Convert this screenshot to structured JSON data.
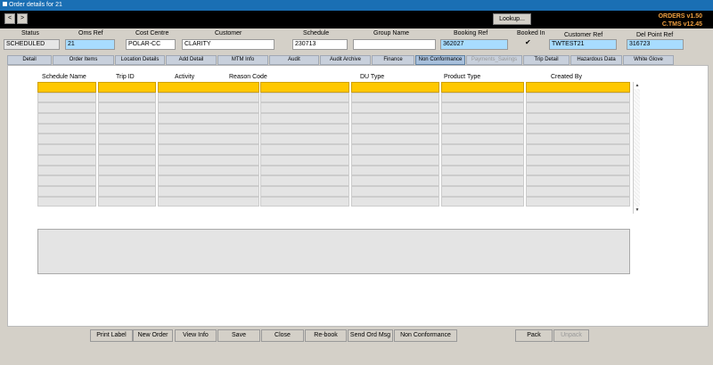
{
  "window": {
    "title": "Order details for 21"
  },
  "toolbar": {
    "prev": "<",
    "next": ">",
    "lookup": "Lookup...",
    "version1": "ORDERS v1.50",
    "version2": "C.TMS v12.45"
  },
  "fields": {
    "status_label": "Status",
    "status_value": "SCHEDULED",
    "oms_label": "Oms Ref",
    "oms_value": "21",
    "cost_label": "Cost Centre",
    "cost_value": "POLAR-CC",
    "customer_label": "Customer",
    "customer_value": "CLARITY",
    "schedule_label": "Schedule",
    "schedule_value": "230713",
    "group_label": "Group Name",
    "group_value": "",
    "booking_label": "Booking Ref",
    "booking_value": "362027",
    "booked_label": "Booked In",
    "booked_mark": "✔",
    "custref_label": "Customer Ref",
    "custref_value": "TWTEST21",
    "delpoint_label": "Del Point Ref",
    "delpoint_value": "316723"
  },
  "tabs": [
    "Detail",
    "Order Items",
    "Location Details",
    "Add Detail",
    "MTM Info",
    "Audit",
    "Audit Archive",
    "Finance",
    "Non Conformance",
    "Payments_Savings",
    "Trip Detail",
    "Hazardous Data",
    "White Glove"
  ],
  "grid": {
    "headers": [
      "Schedule Name",
      "Trip ID",
      "Activity",
      "Reason Code",
      "DU Type",
      "Product Type",
      "Created By"
    ]
  },
  "buttons": [
    "Print Label",
    "New Order",
    "View Info",
    "Save",
    "Close",
    "Re-book",
    "Send Ord Msg",
    "Non Conformance",
    "Pack",
    "Unpack"
  ],
  "colors": {
    "accent": "#1a6fb4",
    "selected": "#ffc800",
    "highlight": "#a8dcff"
  }
}
